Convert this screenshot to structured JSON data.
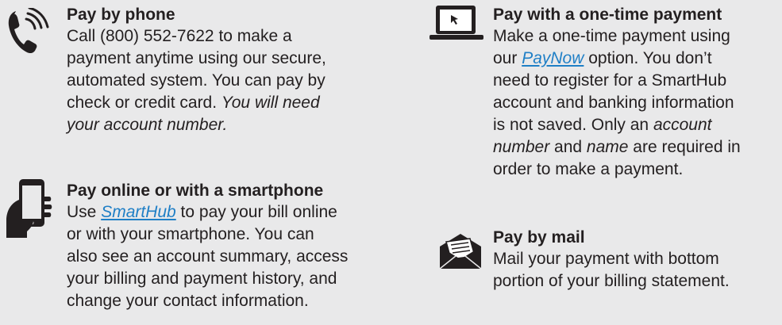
{
  "phone": {
    "title": "Pay by phone",
    "lines": [
      "Call (800) 552-7622 to make a",
      "payment anytime using our secure,",
      "automated system. You can pay by"
    ],
    "line4_plain": "check or credit card. ",
    "line4_italic": "You will need",
    "line5_italic": "your account number."
  },
  "smarthub": {
    "title": "Pay online or with a smartphone",
    "line1_prefix": "Use ",
    "link": "SmartHub",
    "line1_suffix": " to pay your bill online",
    "lines": [
      "or with your smartphone. You can",
      "also see an account summary, access",
      "your billing and payment history, and",
      "change your contact information."
    ]
  },
  "onetime": {
    "title": "Pay with a one-time payment",
    "line1": "Make a one-time payment using",
    "line2_prefix": "our ",
    "link": "PayNow",
    "line2_suffix": " option. You don’t",
    "line3": "need to register for a SmartHub",
    "line4": "account and banking information",
    "line5_plain": "is not saved. Only an ",
    "line5_italic": "account",
    "line6_italic1": "number",
    "line6_plain1": " and ",
    "line6_italic2": "name",
    "line6_plain2": " are required in",
    "line7": "order to make a payment."
  },
  "mail": {
    "title": "Pay by mail",
    "lines": [
      "Mail your payment with bottom",
      "portion of your billing statement."
    ]
  },
  "icons": {
    "phone": "phone-ringing-icon",
    "smartphone": "smartphone-hand-icon",
    "laptop": "laptop-cursor-icon",
    "mail": "envelope-icon"
  },
  "colors": {
    "background": "#e9e9ea",
    "text": "#231f20",
    "link": "#1f7fc6"
  }
}
